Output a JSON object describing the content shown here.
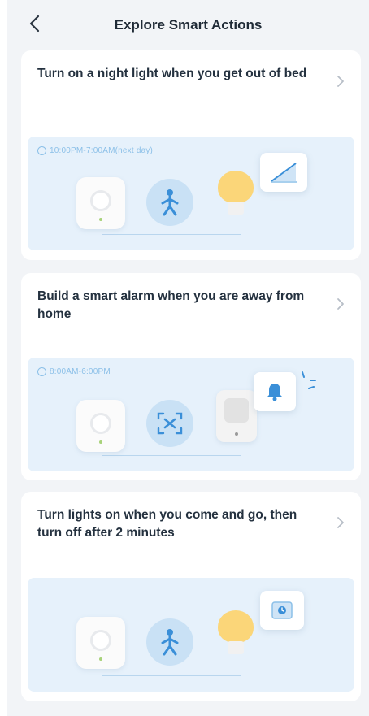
{
  "header": {
    "title": "Explore Smart Actions",
    "back_icon": "chevron-left-icon"
  },
  "cards": [
    {
      "text": "Turn on a night light when you get out of bed",
      "time": "10:00PM-7:00AM(next day)",
      "devices": [
        "hub-icon",
        "motion-sensor-icon",
        "light-bulb-icon",
        "brightness-ramp-icon"
      ]
    },
    {
      "text": "Build a smart alarm when you are away from home",
      "time": "8:00AM-6:00PM",
      "devices": [
        "hub-icon",
        "camera-scan-icon",
        "smart-plug-icon",
        "bell-icon"
      ]
    },
    {
      "text": "Turn lights on when you come and go, then turn off after 2 minutes",
      "time": "",
      "devices": [
        "hub-icon",
        "motion-sensor-icon",
        "light-bulb-icon",
        "timer-icon"
      ]
    }
  ],
  "colors": {
    "background": "#f2f4f7",
    "scene": "#e6f1fb",
    "accent": "#3a8fd8",
    "bulb": "#fbd679"
  }
}
